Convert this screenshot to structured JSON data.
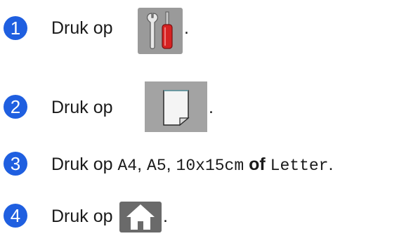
{
  "steps": [
    {
      "number": "1",
      "prefix": "Druk op",
      "suffix": ".",
      "icon": "tools-icon"
    },
    {
      "number": "2",
      "prefix": "Druk op",
      "suffix": ".",
      "icon": "paper-size-icon"
    },
    {
      "number": "3",
      "prefix": "Druk op",
      "options": [
        "A4",
        "A5",
        "10x15cm",
        "Letter"
      ],
      "sep1": ",",
      "sep2": ",",
      "conj": "of",
      "suffix": "."
    },
    {
      "number": "4",
      "prefix": "Druk op",
      "suffix": ".",
      "icon": "home-icon"
    }
  ],
  "colors": {
    "step_badge": "#1f5fe0",
    "button_bg": "#9a9a9a"
  }
}
